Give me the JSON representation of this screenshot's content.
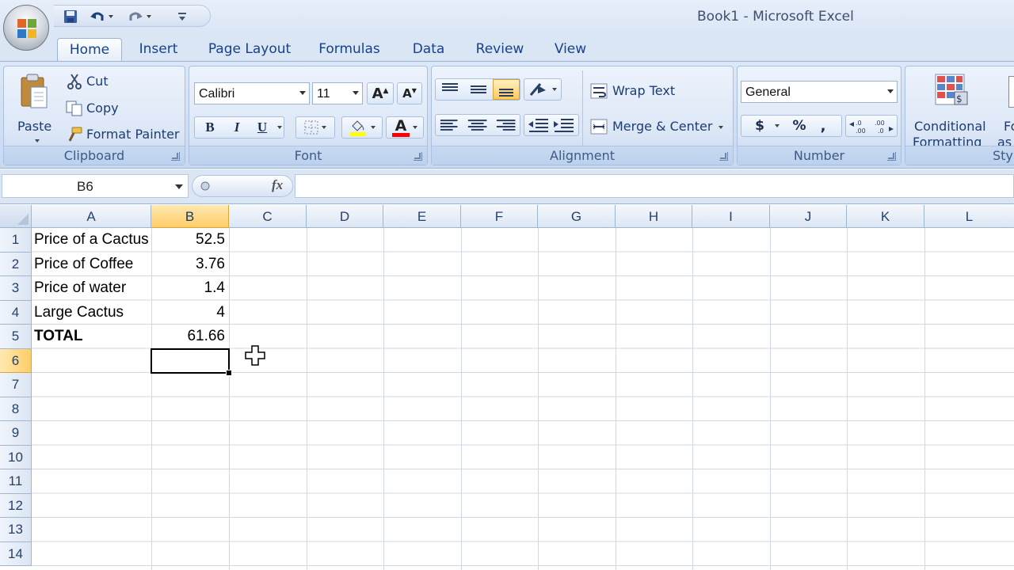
{
  "window": {
    "title": "Book1 - Microsoft Excel"
  },
  "quick_access": {
    "icons": [
      "save-icon",
      "undo-icon",
      "redo-icon",
      "customize-icon"
    ]
  },
  "tabs": [
    {
      "label": "Home",
      "active": true
    },
    {
      "label": "Insert"
    },
    {
      "label": "Page Layout"
    },
    {
      "label": "Formulas"
    },
    {
      "label": "Data"
    },
    {
      "label": "Review"
    },
    {
      "label": "View"
    }
  ],
  "ribbon": {
    "clipboard": {
      "label": "Clipboard",
      "paste": "Paste",
      "cut": "Cut",
      "copy": "Copy",
      "format_painter": "Format Painter"
    },
    "font": {
      "label": "Font",
      "font_name": "Calibri",
      "font_size": "11",
      "bold": "B",
      "italic": "I",
      "underline": "U",
      "font_color": "A"
    },
    "alignment": {
      "label": "Alignment",
      "wrap_text": "Wrap Text",
      "merge_center": "Merge & Center"
    },
    "number": {
      "label": "Number",
      "format": "General",
      "currency": "$",
      "percent": "%",
      "comma": ","
    },
    "styles": {
      "conditional_formatting_1": "Conditional",
      "conditional_formatting_2": "Formatting",
      "format_as_1": "Fo",
      "format_as_2": "as ",
      "label": "Styl"
    },
    "colors": {
      "highlight": "#ffff00",
      "font_color": "#ff0000",
      "accent": "#15428b"
    }
  },
  "formula_bar": {
    "name_box": "B6",
    "fx": "fx",
    "value": ""
  },
  "sheet": {
    "columns": [
      "A",
      "B",
      "C",
      "D",
      "E",
      "F",
      "G",
      "H",
      "I",
      "J",
      "K",
      "L"
    ],
    "selected_column": "B",
    "rows": [
      "1",
      "2",
      "3",
      "4",
      "5",
      "6",
      "7",
      "8",
      "9",
      "10",
      "11",
      "12",
      "13",
      "14"
    ],
    "selected_row": "6",
    "data": [
      {
        "a": "Price of a Cactus",
        "b": "52.5"
      },
      {
        "a": "Price of Coffee",
        "b": "3.76"
      },
      {
        "a": "Price of water",
        "b": "1.4"
      },
      {
        "a": "Large Cactus",
        "b": "4"
      },
      {
        "a": "TOTAL",
        "b": "61.66"
      }
    ],
    "active_cell": "B6"
  }
}
